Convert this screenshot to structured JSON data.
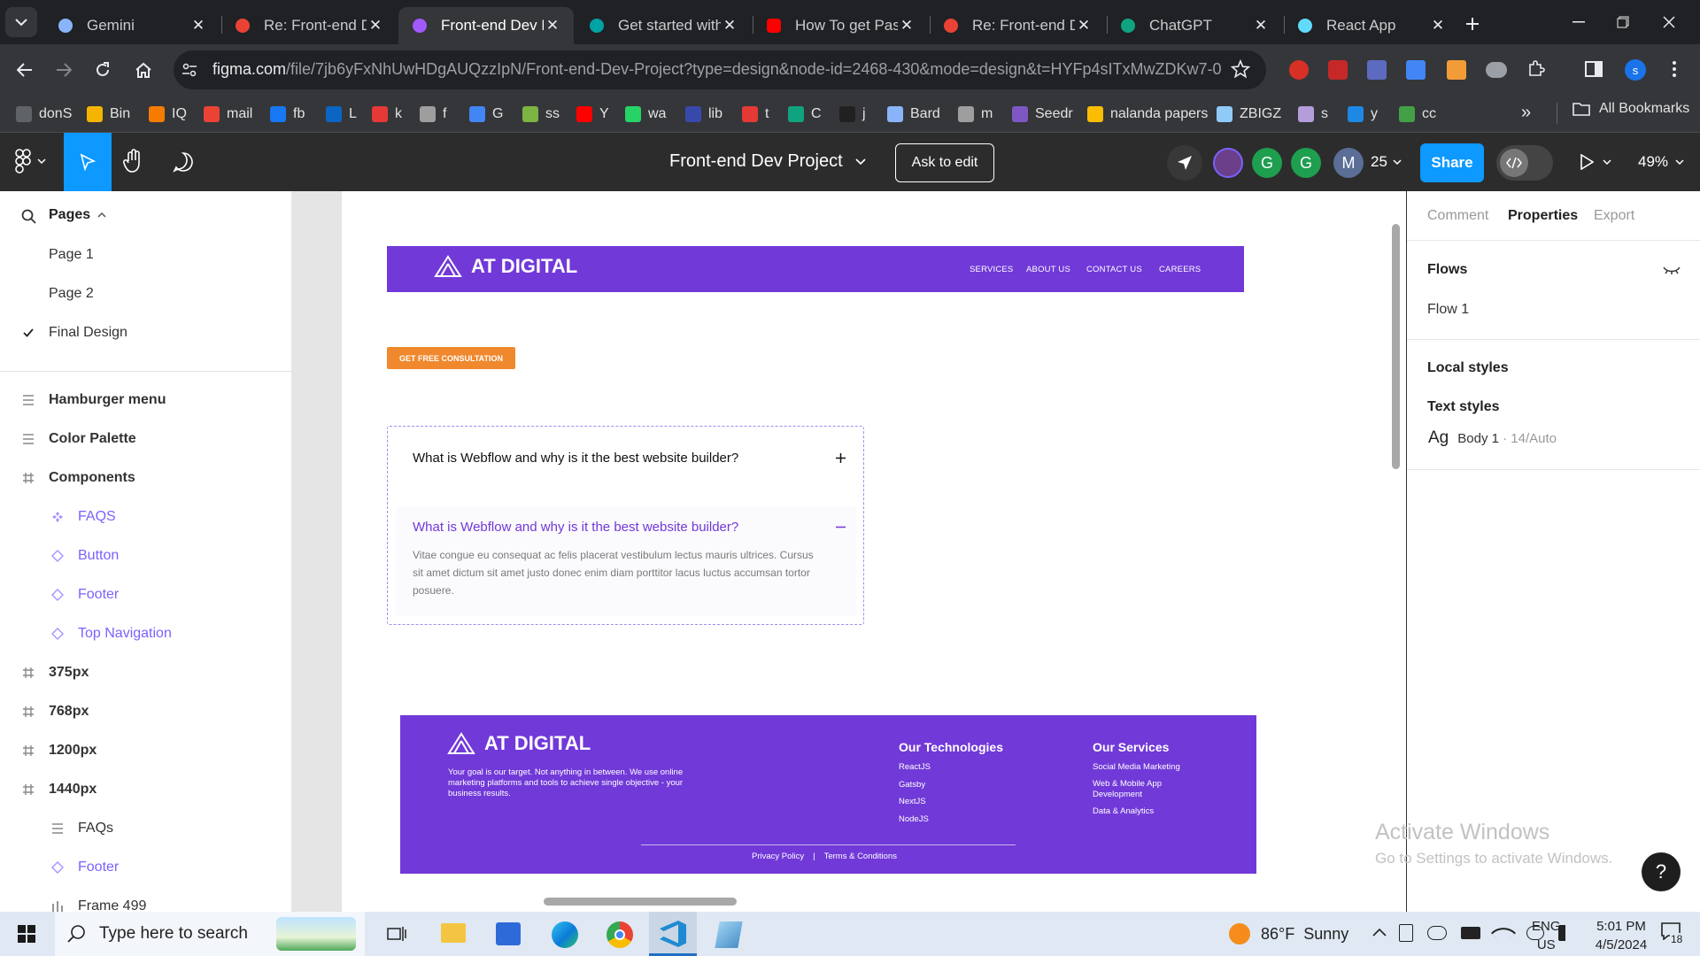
{
  "browser": {
    "tabs": [
      {
        "title": "Gemini",
        "icon": "gemini-icon",
        "color": "#8ab4f8"
      },
      {
        "title": "Re: Front-end De",
        "icon": "gmail-icon",
        "color": "#ea4335"
      },
      {
        "title": "Front-end Dev P",
        "icon": "figma-icon",
        "color": "#a259ff",
        "active": true
      },
      {
        "title": "Get started with",
        "icon": "sparkle-icon",
        "color": "#00a3a3"
      },
      {
        "title": "How To get Pass",
        "icon": "youtube-icon",
        "color": "#ff0000"
      },
      {
        "title": "Re: Front-end De",
        "icon": "gmail-icon",
        "color": "#ea4335"
      },
      {
        "title": "ChatGPT",
        "icon": "chatgpt-icon",
        "color": "#10a37f"
      },
      {
        "title": "React App",
        "icon": "react-icon",
        "color": "#61dafb"
      }
    ],
    "url_host": "figma.com",
    "url_path": "/file/7jb6yFxNhUwHDgAUQzzIpN/Front-end-Dev-Project?type=design&node-id=2468-430&mode=design&t=HYFp4sITxMwZDKw7-0",
    "profile_initial": "s",
    "bookmarks": [
      {
        "label": "donS",
        "color": "#5f6368"
      },
      {
        "label": "Bin",
        "color": "#f4b400"
      },
      {
        "label": "IQ",
        "color": "#f57c00"
      },
      {
        "label": "mail",
        "color": "#ea4335"
      },
      {
        "label": "fb",
        "color": "#1877f2"
      },
      {
        "label": "L",
        "color": "#0a66c2"
      },
      {
        "label": "k",
        "color": "#e53935"
      },
      {
        "label": "f",
        "color": "#9e9e9e"
      },
      {
        "label": "G",
        "color": "#4285f4"
      },
      {
        "label": "ss",
        "color": "#7cb342"
      },
      {
        "label": "Y",
        "color": "#ff0000"
      },
      {
        "label": "wa",
        "color": "#25d366"
      },
      {
        "label": "lib",
        "color": "#3949ab"
      },
      {
        "label": "t",
        "color": "#e53935"
      },
      {
        "label": "C",
        "color": "#10a37f"
      },
      {
        "label": "j",
        "color": "#212121"
      },
      {
        "label": "Bard",
        "color": "#8ab4f8"
      },
      {
        "label": "m",
        "color": "#9e9e9e"
      },
      {
        "label": "Seedr",
        "color": "#7e57c2"
      },
      {
        "label": "nalanda papers",
        "color": "#fbbc04"
      },
      {
        "label": "ZBIGZ",
        "color": "#90caf9"
      },
      {
        "label": "s",
        "color": "#b39ddb"
      },
      {
        "label": "y",
        "color": "#1e88e5"
      },
      {
        "label": "cc",
        "color": "#43a047"
      }
    ],
    "all_bookmarks": "All Bookmarks"
  },
  "figma": {
    "file_title": "Front-end Dev Project",
    "ask_to_edit": "Ask to edit",
    "avatars": [
      {
        "letter": "G",
        "color": "#1e9e4f"
      },
      {
        "letter": "G",
        "color": "#1e9e4f"
      },
      {
        "letter": "M",
        "color": "#5a6e96"
      }
    ],
    "user_count": "25",
    "share": "Share",
    "zoom": "49%",
    "accent": "#0d99ff"
  },
  "left_panel": {
    "pages_title": "Pages",
    "pages": [
      "Page 1",
      "Page 2",
      "Final Design"
    ],
    "current_page": "Final Design",
    "layers": [
      {
        "label": "Hamburger menu",
        "icon": "group-icon",
        "kind": "top"
      },
      {
        "label": "Color Palette",
        "icon": "group-icon",
        "kind": "top"
      },
      {
        "label": "Components",
        "icon": "frame-icon",
        "kind": "top"
      },
      {
        "label": "FAQS",
        "icon": "component-icon",
        "kind": "comp"
      },
      {
        "label": "Button",
        "icon": "instance-icon",
        "kind": "comp"
      },
      {
        "label": "Footer",
        "icon": "instance-icon",
        "kind": "comp"
      },
      {
        "label": "Top Navigation",
        "icon": "instance-icon",
        "kind": "comp"
      },
      {
        "label": "375px",
        "icon": "frame-icon",
        "kind": "top"
      },
      {
        "label": "768px",
        "icon": "frame-icon",
        "kind": "top"
      },
      {
        "label": "1200px",
        "icon": "frame-icon",
        "kind": "top"
      },
      {
        "label": "1440px",
        "icon": "frame-icon",
        "kind": "top"
      },
      {
        "label": "FAQs",
        "icon": "group-icon",
        "kind": "sub"
      },
      {
        "label": "Footer",
        "icon": "instance-icon",
        "kind": "compsub"
      },
      {
        "label": "Frame 499",
        "icon": "columns-icon",
        "kind": "sub"
      }
    ]
  },
  "design": {
    "brand_color": "#7139d8",
    "nav_logo": "AT DIGITAL",
    "nav_links": [
      "SERVICES",
      "ABOUT US",
      "CONTACT US",
      "CAREERS"
    ],
    "cta": "GET FREE CONSULTATION",
    "cta_color": "#f0882d",
    "faq_q1": "What is Webflow and why is it the best website builder?",
    "faq_q2": "What is Webflow and why is it the best website builder?",
    "faq_a2": "Vitae congue eu consequat ac felis placerat vestibulum lectus mauris ultrices. Cursus sit amet dictum sit amet justo donec enim diam porttitor lacus luctus accumsan tortor posuere.",
    "footer_logo": "AT DIGITAL",
    "footer_tagline": "Your goal is our target. Not anything in between. We use online marketing platforms and tools to achieve single objective - your business results.",
    "tech_title": "Our Technologies",
    "tech_items": [
      "ReactJS",
      "Gatsby",
      "NextJS",
      "NodeJS"
    ],
    "services_title": "Our Services",
    "services_items": [
      "Social Media Marketing",
      "Web & Mobile App Development",
      "Data & Analytics"
    ],
    "privacy": "Privacy Policy",
    "divider": "|",
    "terms": "Terms & Conditions"
  },
  "right_panel": {
    "tabs": [
      "Comment",
      "Properties",
      "Export"
    ],
    "active_tab": "Properties",
    "flows_title": "Flows",
    "flow_item": "Flow 1",
    "local_styles": "Local styles",
    "text_styles": "Text styles",
    "style_ag": "Ag",
    "style_name": "Body 1",
    "style_meta": " · 14/Auto",
    "watermark_title": "Activate Windows",
    "watermark_sub": "Go to Settings to activate Windows.",
    "help": "?"
  },
  "taskbar": {
    "search_placeholder": "Type here to search",
    "weather": "86°F  Sunny",
    "lang1": "ENG",
    "lang2": "US",
    "time": "5:01 PM",
    "date": "4/5/2024",
    "notif_count": "18"
  }
}
